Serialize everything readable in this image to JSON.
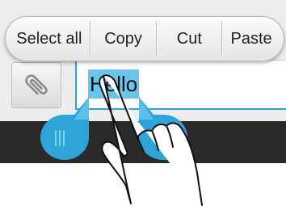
{
  "context_menu": {
    "select_all": "Select all",
    "copy": "Copy",
    "cut": "Cut",
    "paste": "Paste"
  },
  "attach_button": {
    "icon": "paperclip-icon"
  },
  "input": {
    "value": "Hello"
  },
  "colors": {
    "selection_highlight": "#6cc5e8",
    "handle": "#2fa4d8",
    "field_underline": "#2fa4d8",
    "dark_bar": "#2a2a2a"
  }
}
